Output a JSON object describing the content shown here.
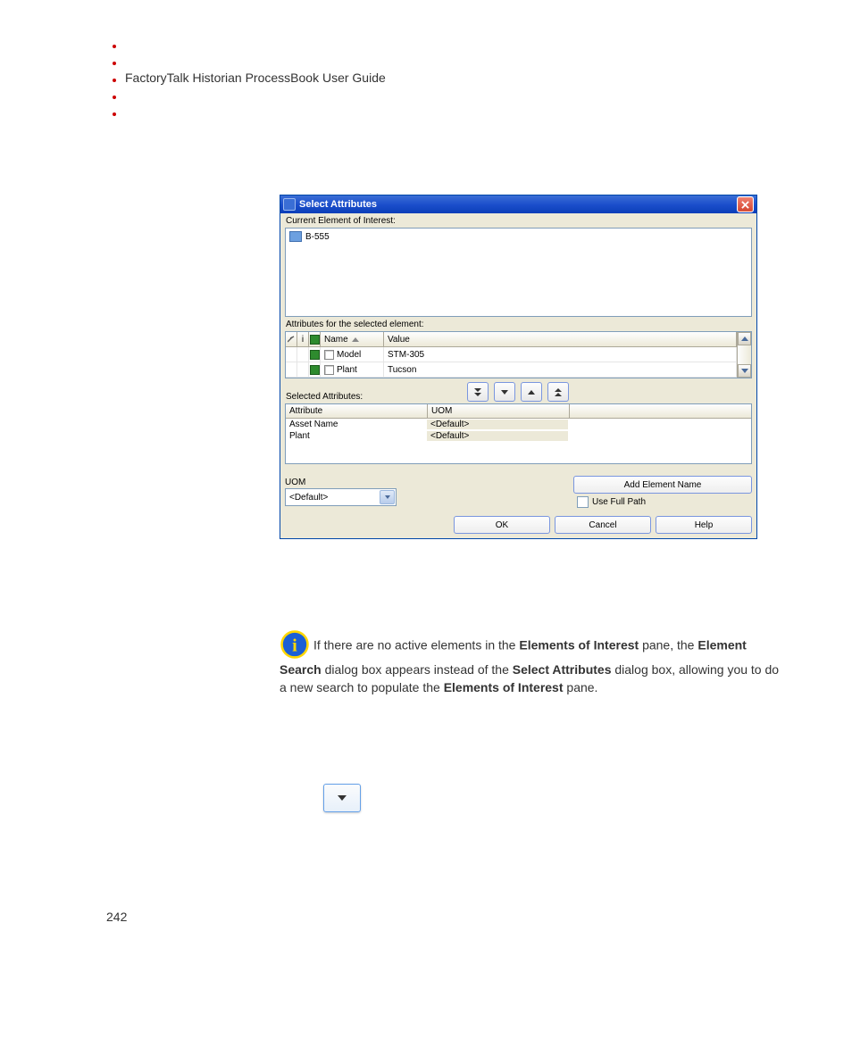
{
  "header": {
    "title": "FactoryTalk Historian ProcessBook User Guide"
  },
  "dialog": {
    "title": "Select Attributes",
    "label_current_element": "Current Element of Interest:",
    "tree_item": "B-555",
    "label_attributes": "Attributes for the selected element:",
    "cols": {
      "name": "Name",
      "value": "Value"
    },
    "rows": [
      {
        "name": "Model",
        "value": "STM-305"
      },
      {
        "name": "Plant",
        "value": "Tucson"
      }
    ],
    "label_selected": "Selected Attributes:",
    "sel_cols": {
      "attribute": "Attribute",
      "uom": "UOM"
    },
    "sel_rows": [
      {
        "attribute": "Asset Name",
        "uom": "<Default>"
      },
      {
        "attribute": "Plant",
        "uom": "<Default>"
      }
    ],
    "uom_label": "UOM",
    "uom_value": "<Default>",
    "btn_add_element": "Add Element Name",
    "fullpath_label": "Use Full Path",
    "btn_ok": "OK",
    "btn_cancel": "Cancel",
    "btn_help": "Help"
  },
  "info": {
    "t1": "If there are no active elements in the ",
    "b1": "Elements of Interest",
    "t2": " pane, the ",
    "b2": "Element Search",
    "t3": " dialog box appears instead of the ",
    "b3": "Select Attributes",
    "t4": " dialog box, allowing you to do a new search to populate the ",
    "b4": "Elements of Interest",
    "t5": " pane."
  },
  "page_number": "242"
}
